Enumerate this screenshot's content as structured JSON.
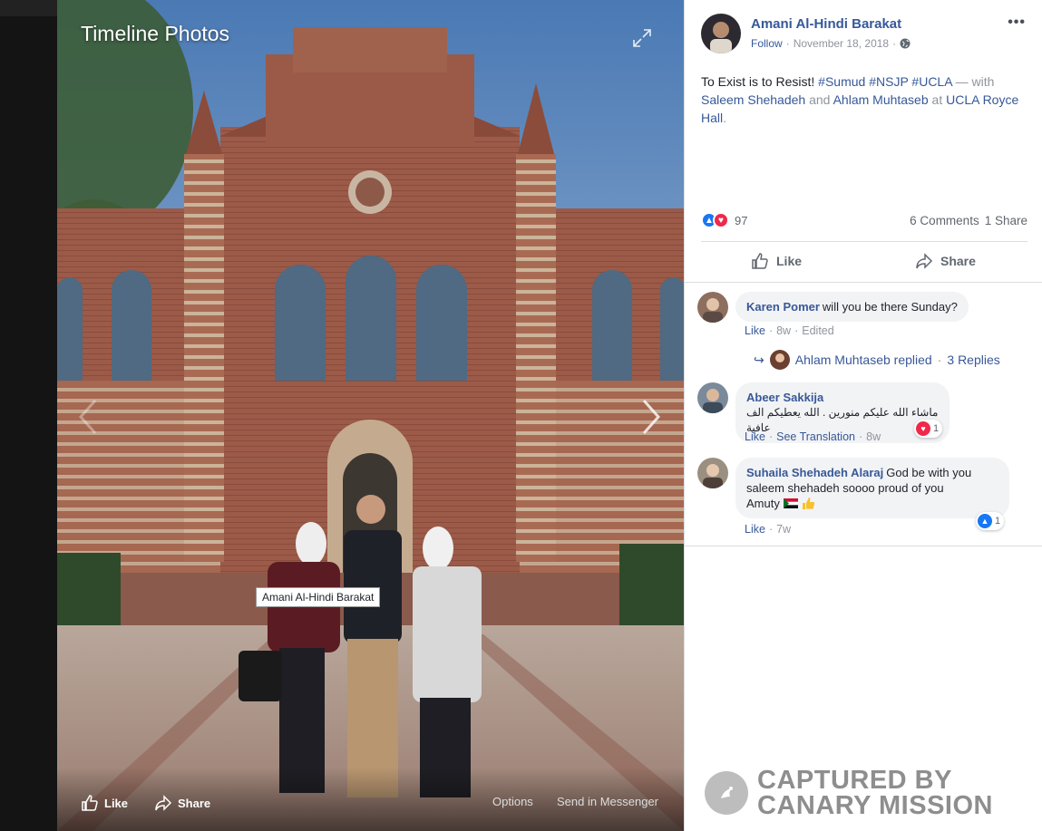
{
  "viewer": {
    "title": "Timeline Photos",
    "tag_label": "Amani Al-Hindi Barakat",
    "footer": {
      "like": "Like",
      "share": "Share",
      "options": "Options",
      "send": "Send in Messenger"
    }
  },
  "post": {
    "author": "Amani Al-Hindi Barakat",
    "follow": "Follow",
    "dot": "·",
    "date": "November 18, 2018",
    "text_start": "To Exist is to Resist! ",
    "hashtags": [
      "#Sumud",
      "#NSJP",
      "#UCLA"
    ],
    "with_prefix": " — with",
    "with_person_1": "Saleem Shehadeh",
    "and": "and",
    "with_person_2": "Ahlam Muhtaseb",
    "at": "at",
    "place": "UCLA Royce Hall",
    "period": ".",
    "reaction_count": "97",
    "comments": "6 Comments",
    "shares": "1 Share",
    "like_label": "Like",
    "share_label": "Share"
  },
  "comments": [
    {
      "name": "Karen Pomer",
      "text": "will you be there Sunday?",
      "like": "Like",
      "time": "8w",
      "edited": "Edited",
      "reply_author": "Ahlam Muhtaseb replied",
      "reply_count": "3 Replies"
    },
    {
      "name": "Abeer Sakkija",
      "text": "ماشاء الله عليكم منورين . الله يعطيكم الف عافية",
      "like": "Like",
      "translate": "See Translation",
      "time": "8w",
      "reaction_count": "1"
    },
    {
      "name": "Suhaila Shehadeh Alaraj",
      "text_1": "God be with you",
      "text_2": "saleem shehadeh soooo proud of you",
      "text_3": "Amuty",
      "like": "Like",
      "time": "7w",
      "reaction_count": "1"
    }
  ],
  "watermark": {
    "line1": "CAPTURED BY",
    "line2": "CANARY MISSION"
  },
  "colors": {
    "link": "#365899",
    "muted": "#90949c",
    "like_blue": "#1877f2",
    "love_red": "#f0284a"
  }
}
